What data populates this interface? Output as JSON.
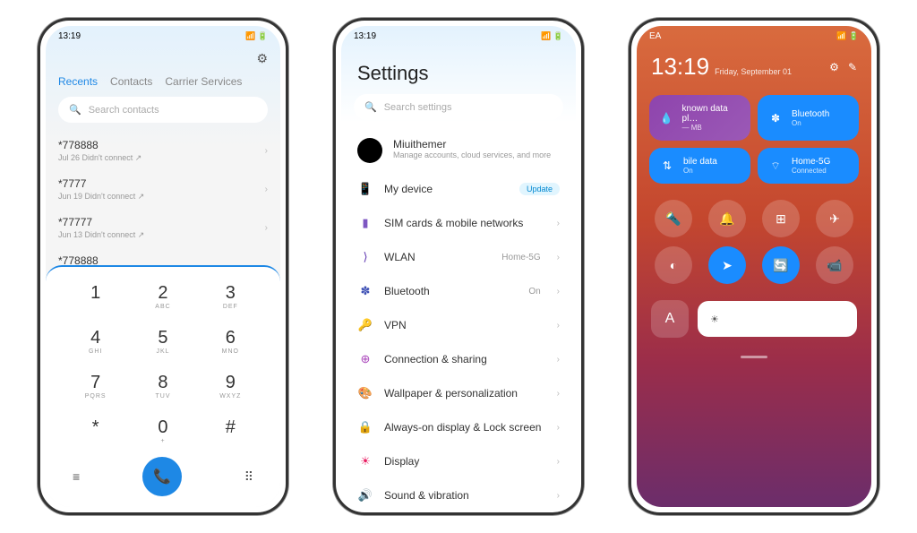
{
  "status": {
    "time": "13:19",
    "icons": "ᵇᵗ ⁴ᴳ ⚡ 📶 🔋"
  },
  "phone1": {
    "tabs": [
      "Recents",
      "Contacts",
      "Carrier Services"
    ],
    "active_tab": 0,
    "search_placeholder": "Search contacts",
    "calls": [
      {
        "number": "*778888",
        "meta": "Jul 26 Didn't connect ↗"
      },
      {
        "number": "*7777",
        "meta": "Jun 19 Didn't connect ↗"
      },
      {
        "number": "*77777",
        "meta": "Jun 13 Didn't connect ↗"
      },
      {
        "number": "*778888",
        "meta": ""
      }
    ],
    "keys": [
      [
        "1",
        ""
      ],
      [
        "2",
        "ABC"
      ],
      [
        "3",
        "DEF"
      ],
      [
        "4",
        "GHI"
      ],
      [
        "5",
        "JKL"
      ],
      [
        "6",
        "MNO"
      ],
      [
        "7",
        "PQRS"
      ],
      [
        "8",
        "TUV"
      ],
      [
        "9",
        "WXYZ"
      ],
      [
        "*",
        ""
      ],
      [
        "0",
        "+"
      ],
      [
        "#",
        ""
      ]
    ]
  },
  "phone2": {
    "title": "Settings",
    "search_placeholder": "Search settings",
    "profile": {
      "name": "Miuithemer",
      "sub": "Manage accounts, cloud services, and more"
    },
    "items": [
      {
        "icon": "📱",
        "color": "#1e88e5",
        "label": "My device",
        "badge": "Update"
      },
      {
        "icon": "▮",
        "color": "#7e57c2",
        "label": "SIM cards & mobile networks"
      },
      {
        "icon": "⟩",
        "color": "#5e35b1",
        "label": "WLAN",
        "value": "Home-5G"
      },
      {
        "icon": "✽",
        "color": "#3f51b5",
        "label": "Bluetooth",
        "value": "On"
      },
      {
        "icon": "🔑",
        "color": "#8e24aa",
        "label": "VPN"
      },
      {
        "icon": "⊕",
        "color": "#ab47bc",
        "label": "Connection & sharing"
      },
      {
        "icon": "🎨",
        "color": "#e91e63",
        "label": "Wallpaper & personalization"
      },
      {
        "icon": "🔒",
        "color": "#d81b60",
        "label": "Always-on display & Lock screen"
      },
      {
        "icon": "☀",
        "color": "#e91e63",
        "label": "Display"
      },
      {
        "icon": "🔊",
        "color": "#c2185b",
        "label": "Sound & vibration"
      }
    ]
  },
  "phone3": {
    "carrier": "EA",
    "time": "13:19",
    "date": "Friday, September 01",
    "tiles": [
      {
        "title": "known data pl…",
        "sub": "— MB",
        "icon": "💧"
      },
      {
        "title": "Bluetooth",
        "sub": "On",
        "icon": "✽"
      },
      {
        "title": "bile data",
        "sub": "On",
        "icon": "⇅"
      },
      {
        "title": "Home-5G",
        "sub": "Connected",
        "icon": "⌔"
      }
    ],
    "toggles": [
      {
        "icon": "🔦",
        "on": false
      },
      {
        "icon": "🔔",
        "on": false
      },
      {
        "icon": "⊞",
        "on": false
      },
      {
        "icon": "✈",
        "on": false
      },
      {
        "icon": "◐",
        "on": false
      },
      {
        "icon": "➤",
        "on": true
      },
      {
        "icon": "🔄",
        "on": true
      },
      {
        "icon": "📹",
        "on": false
      }
    ],
    "auto_bright": "A"
  }
}
